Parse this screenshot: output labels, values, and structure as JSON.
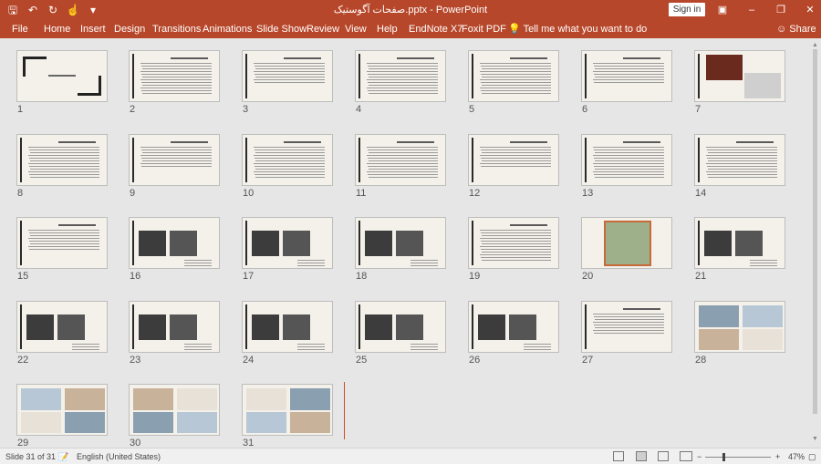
{
  "app": {
    "doc_title": "صفحات آگوستیک.pptx  -  PowerPoint",
    "signin_label": "Sign in"
  },
  "qat": {
    "save_icon": "save-icon",
    "undo_icon": "undo-icon",
    "redo_icon": "repeat-icon",
    "touch_icon": "touch-mode-icon"
  },
  "ribbon": {
    "tabs": [
      "File",
      "Home",
      "Insert",
      "Design",
      "Transitions",
      "Animations",
      "Slide Show",
      "Review",
      "View",
      "Help",
      "EndNote X7",
      "Foxit PDF"
    ],
    "tell_me": "Tell me what you want to do",
    "share": "Share"
  },
  "slides": [
    "1",
    "2",
    "3",
    "4",
    "5",
    "6",
    "7",
    "8",
    "9",
    "10",
    "11",
    "12",
    "13",
    "14",
    "15",
    "16",
    "17",
    "18",
    "19",
    "20",
    "21",
    "22",
    "23",
    "24",
    "25",
    "26",
    "27",
    "28",
    "29",
    "30",
    "31"
  ],
  "status": {
    "slide_info": "Slide 31 of 31",
    "language": "English (United States)",
    "zoom": "47%",
    "zoom_minus": "−",
    "zoom_plus": "+"
  },
  "colors": {
    "accent": "#b7472a",
    "slide_bg": "#f3f1ea",
    "insert_marker": "#d24726"
  }
}
